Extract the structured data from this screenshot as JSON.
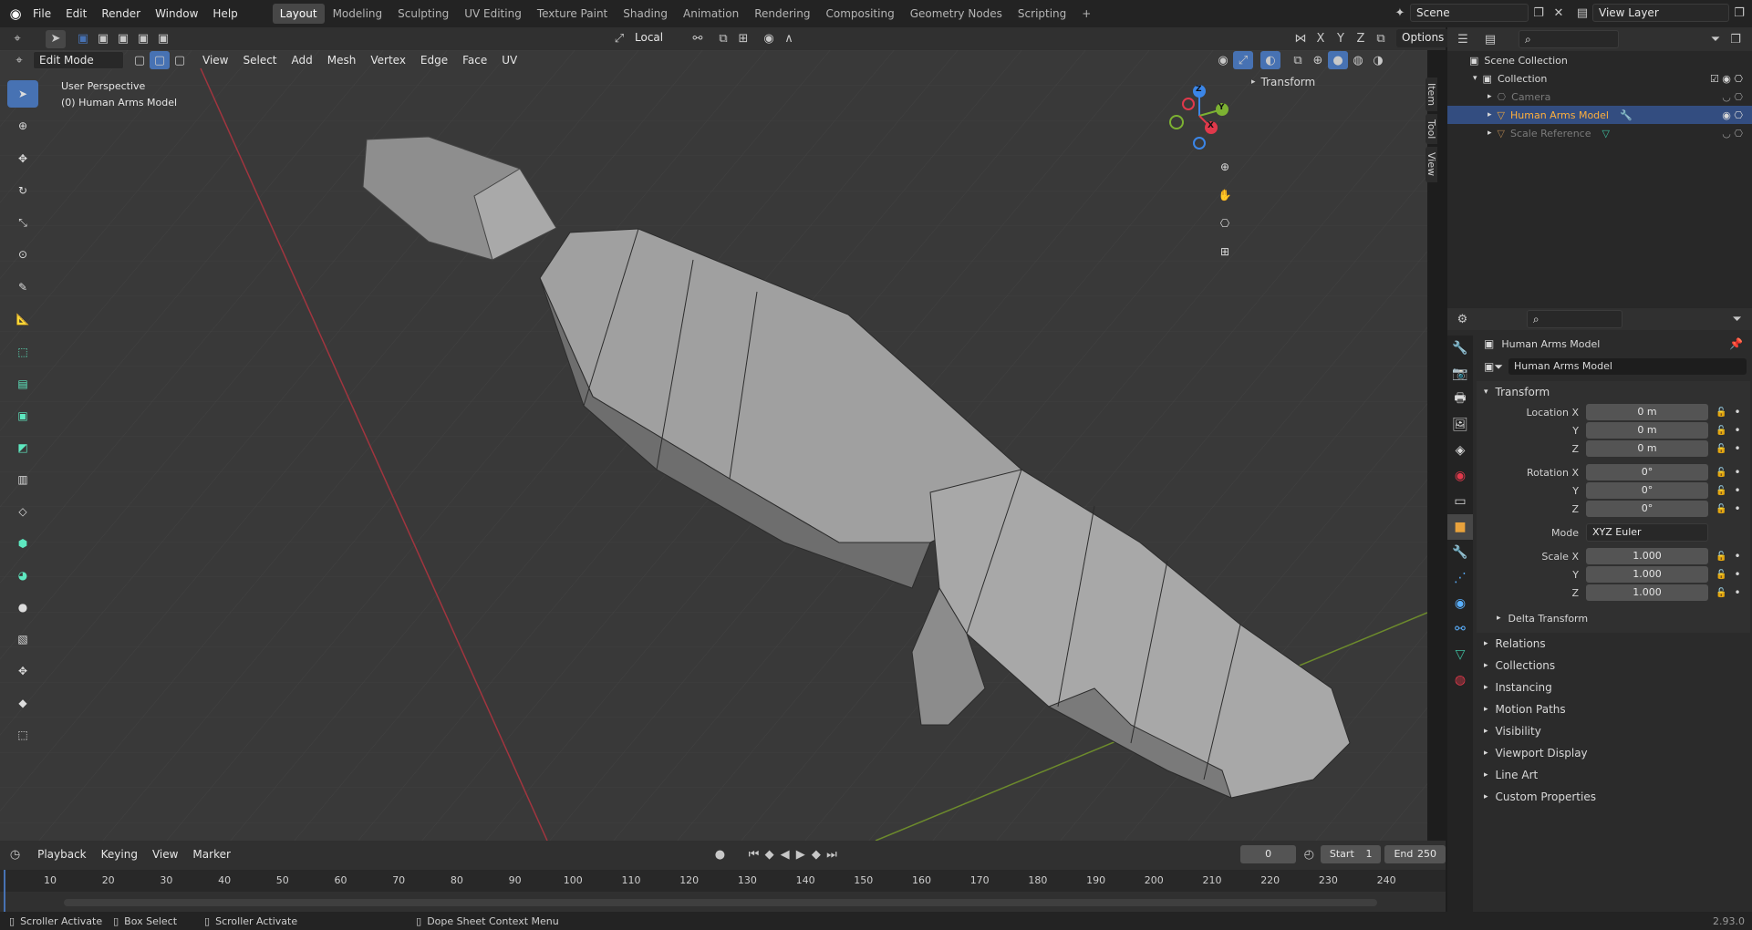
{
  "topbar": {
    "menus": [
      "File",
      "Edit",
      "Render",
      "Window",
      "Help"
    ],
    "workspaces": [
      "Layout",
      "Modeling",
      "Sculpting",
      "UV Editing",
      "Texture Paint",
      "Shading",
      "Animation",
      "Rendering",
      "Compositing",
      "Geometry Nodes",
      "Scripting"
    ],
    "active_workspace": "Layout",
    "add_tab_label": "+",
    "scene_label": "Scene",
    "view_layer_label": "View Layer"
  },
  "header": {
    "mode": "Edit Mode",
    "menus": [
      "View",
      "Select",
      "Add",
      "Mesh",
      "Vertex",
      "Edge",
      "Face",
      "UV"
    ],
    "transform_orientation": "Local",
    "options_label": "Options",
    "axis_x": "X",
    "axis_y": "Y",
    "axis_z": "Z"
  },
  "viewport": {
    "perspective_label": "User Perspective",
    "object_label": "(0) Human Arms Model",
    "transform_panel_title": "Transform",
    "gizmo": {
      "x": "X",
      "y": "Y",
      "z": "Z"
    },
    "side_tabs": [
      "Item",
      "Tool",
      "View"
    ]
  },
  "outliner": {
    "root": "Scene Collection",
    "collection": "Collection",
    "items": [
      {
        "label": "Camera",
        "selected": false,
        "color": "#7a7a7a"
      },
      {
        "label": "Human Arms Model",
        "selected": true,
        "color": "#e8a23c"
      },
      {
        "label": "Scale Reference",
        "selected": false,
        "color": "#7a7a7a"
      }
    ]
  },
  "properties": {
    "object_title": "Human Arms Model",
    "object_name_field": "Human Arms Model",
    "transform_title": "Transform",
    "location_label": "Location X",
    "rotation_label": "Rotation X",
    "scale_label": "Scale X",
    "y_label": "Y",
    "z_label": "Z",
    "location": [
      "0 m",
      "0 m",
      "0 m"
    ],
    "rotation": [
      "0°",
      "0°",
      "0°"
    ],
    "mode_label": "Mode",
    "mode_value": "XYZ Euler",
    "scale": [
      "1.000",
      "1.000",
      "1.000"
    ],
    "delta_transform": "Delta Transform",
    "sections": [
      "Relations",
      "Collections",
      "Instancing",
      "Motion Paths",
      "Visibility",
      "Viewport Display",
      "Line Art",
      "Custom Properties"
    ]
  },
  "timeline": {
    "menus": [
      "Playback",
      "Keying",
      "View",
      "Marker"
    ],
    "current_frame": "0",
    "start_label": "Start",
    "start_value": "1",
    "end_label": "End",
    "end_value": "250",
    "ticks": [
      "10",
      "20",
      "30",
      "40",
      "50",
      "60",
      "70",
      "80",
      "90",
      "100",
      "110",
      "120",
      "130",
      "140",
      "150",
      "160",
      "170",
      "180",
      "190",
      "200",
      "210",
      "220",
      "230",
      "240"
    ]
  },
  "statusbar": {
    "items": [
      "Scroller Activate",
      "Box Select",
      "Scroller Activate",
      "Dope Sheet Context Menu"
    ],
    "version": "2.93.0"
  },
  "colors": {
    "accent": "#4772b3",
    "x_axis": "#e0394b",
    "y_axis": "#7cb132",
    "z_axis": "#3b86e8"
  }
}
